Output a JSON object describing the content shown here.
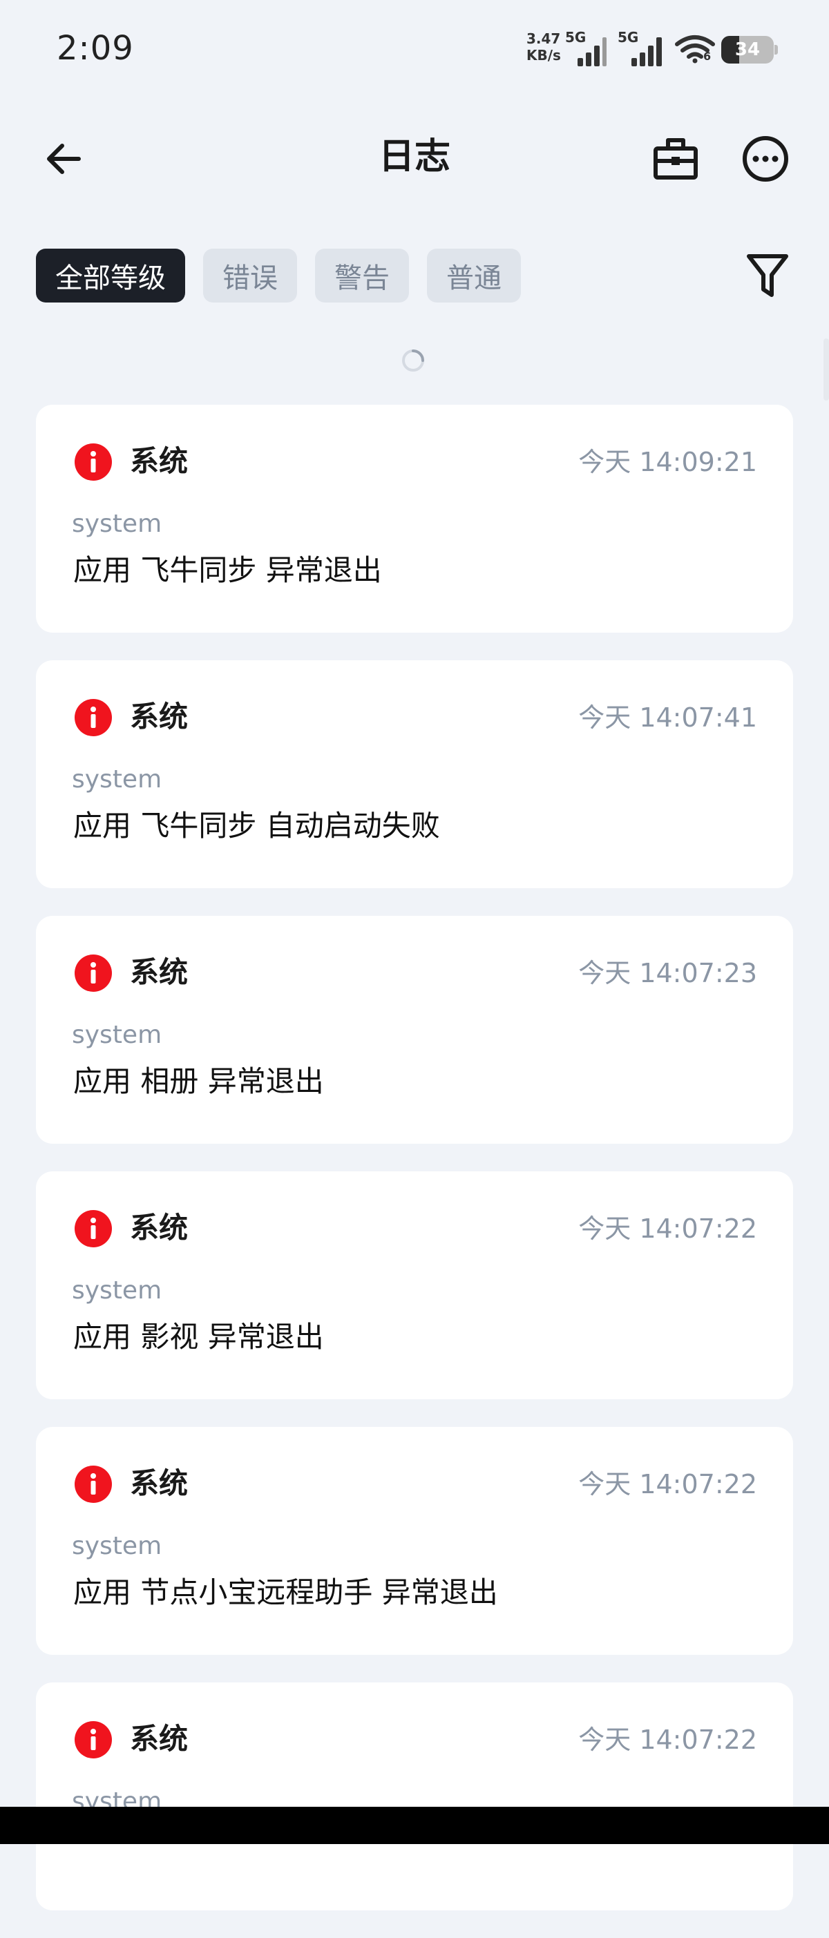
{
  "status_bar": {
    "time": "2:09",
    "net_speed_value": "3.47",
    "net_speed_unit": "KB/s",
    "signal1_tag": "5G",
    "signal2_tag": "5G",
    "wifi_tag": "6",
    "battery": "34"
  },
  "header": {
    "title": "日志",
    "back_icon": "arrow-left-icon",
    "toolbox_icon": "toolbox-icon",
    "more_icon": "more-icon"
  },
  "filters": {
    "chips": [
      "全部等级",
      "错误",
      "警告",
      "普通"
    ],
    "active": "全部等级",
    "filter_icon": "funnel-icon"
  },
  "logs": [
    {
      "source": "系统",
      "time": "今天 14:09:21",
      "category": "system",
      "message": "应用 飞牛同步 异常退出"
    },
    {
      "source": "系统",
      "time": "今天 14:07:41",
      "category": "system",
      "message": "应用 飞牛同步 自动启动失败"
    },
    {
      "source": "系统",
      "time": "今天 14:07:23",
      "category": "system",
      "message": "应用 相册 异常退出"
    },
    {
      "source": "系统",
      "time": "今天 14:07:22",
      "category": "system",
      "message": "应用 影视 异常退出"
    },
    {
      "source": "系统",
      "time": "今天 14:07:22",
      "category": "system",
      "message": "应用 节点小宝远程助手 异常退出"
    },
    {
      "source": "系统",
      "time": "今天 14:07:22",
      "category": "system",
      "message": ""
    }
  ],
  "colors": {
    "background": "#f0f3f8",
    "error": "#f0141e",
    "muted": "#8b96a5",
    "chip_active": "#1c2028"
  }
}
